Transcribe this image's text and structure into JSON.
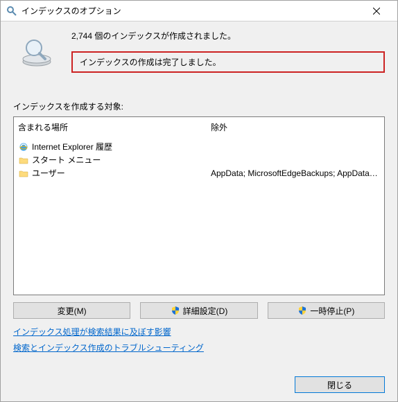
{
  "window": {
    "title": "インデックスのオプション"
  },
  "header": {
    "count_text": "2,744 個のインデックスが作成されました。",
    "status_text": "インデックスの作成は完了しました。"
  },
  "targets": {
    "label": "インデックスを作成する対象:",
    "columns": {
      "location": "含まれる場所",
      "exclude": "除外"
    },
    "rows": [
      {
        "icon": "ie-icon",
        "label": "Internet Explorer 履歴",
        "exclude": ""
      },
      {
        "icon": "folder-icon",
        "label": "スタート メニュー",
        "exclude": ""
      },
      {
        "icon": "folder-icon",
        "label": "ユーザー",
        "exclude": "AppData; MicrosoftEdgeBackups; AppData; Mi..."
      }
    ]
  },
  "buttons": {
    "modify": "変更(M)",
    "advanced": "詳細設定(D)",
    "pause": "一時停止(P)"
  },
  "links": {
    "impact": "インデックス処理が検索結果に及ぼす影響",
    "troubleshoot": "検索とインデックス作成のトラブルシューティング"
  },
  "footer": {
    "close": "閉じる"
  }
}
